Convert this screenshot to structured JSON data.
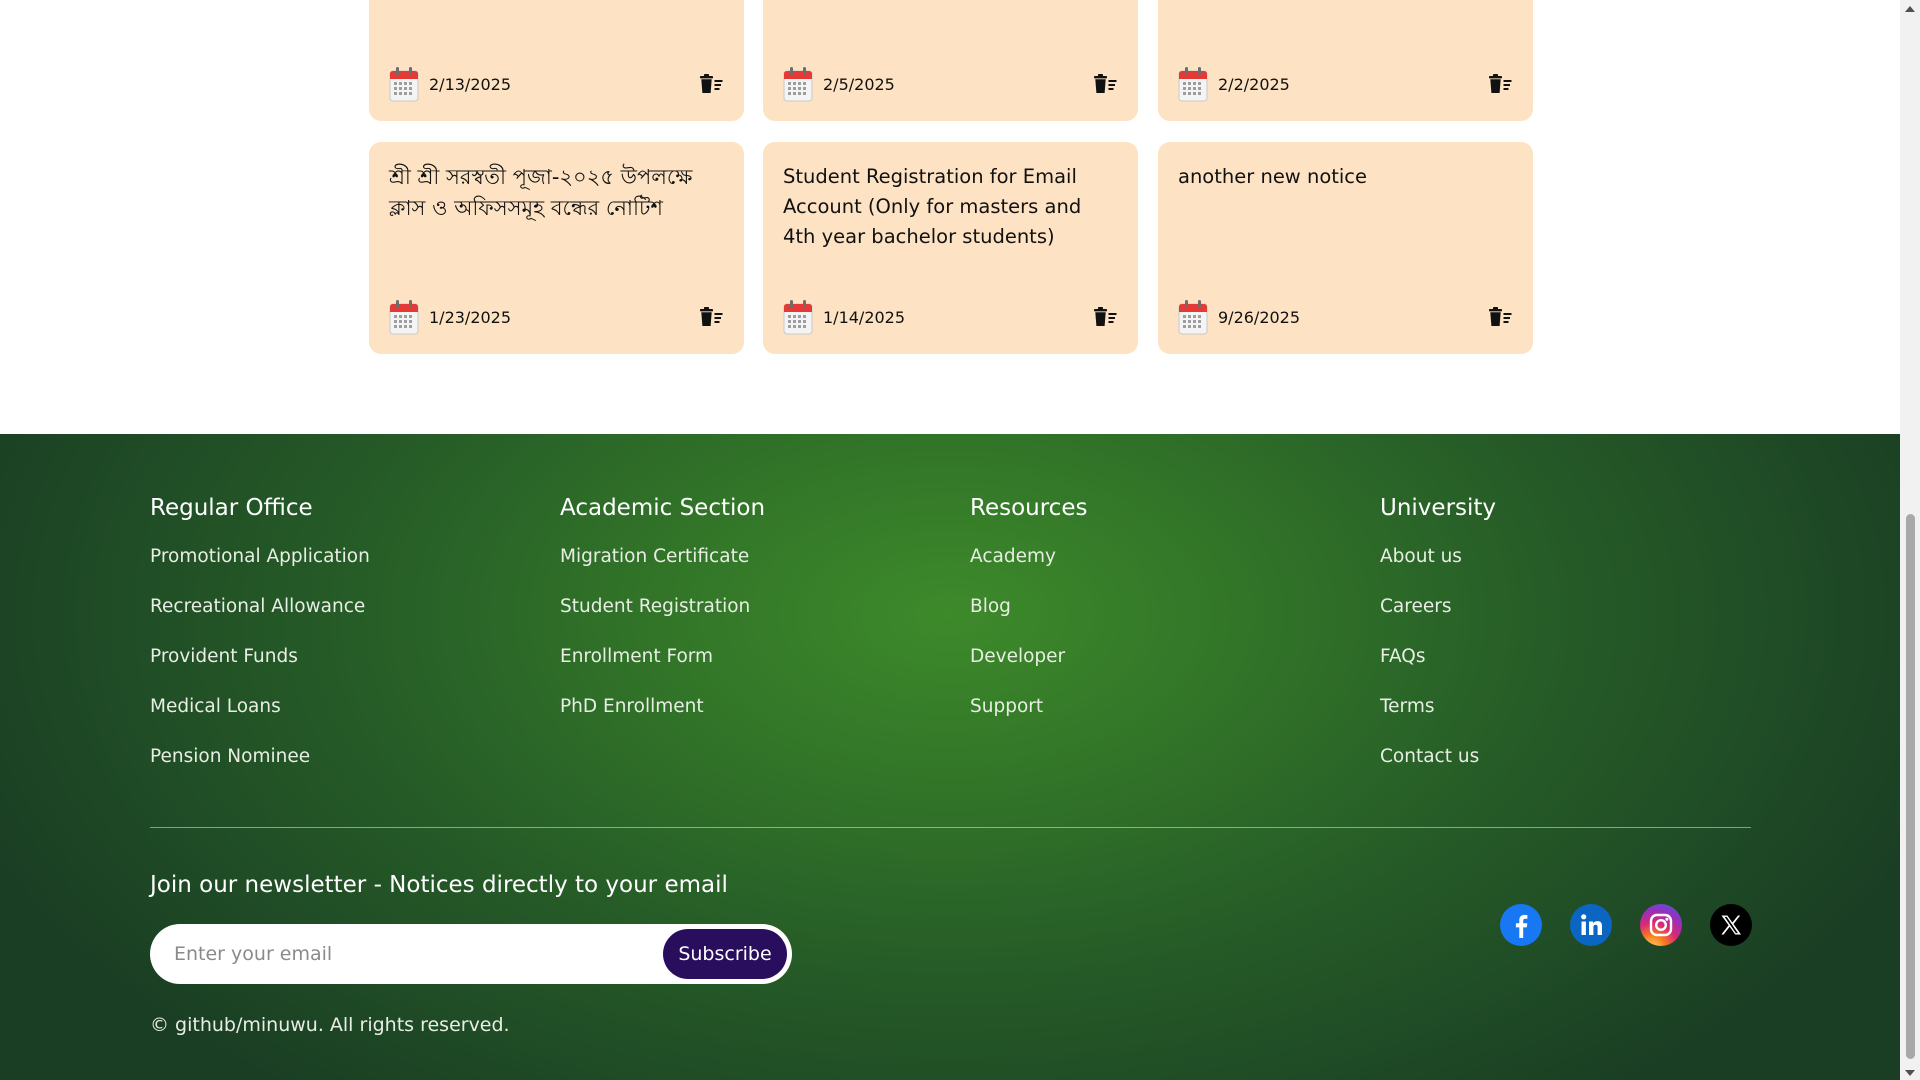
{
  "notices": {
    "row1": [
      {
        "title": "",
        "date": "2/13/2025",
        "icon": "calendar-icon",
        "action_icon": "delete-icon"
      },
      {
        "title": "",
        "date": "2/5/2025",
        "icon": "calendar-icon",
        "action_icon": "delete-icon"
      },
      {
        "title": "",
        "date": "2/2/2025",
        "icon": "calendar-icon",
        "action_icon": "delete-icon"
      }
    ],
    "row2": [
      {
        "title": "শ্রী শ্রী সরস্বতী পূজা-২০২৫ উপলক্ষে ক্লাস ও অফিসসমূহ বন্ধের নোটিশ",
        "date": "1/23/2025",
        "icon": "calendar-icon",
        "action_icon": "delete-icon"
      },
      {
        "title": "Student Registration for Email Account (Only for masters and 4th year bachelor students)",
        "date": "1/14/2025",
        "icon": "calendar-icon",
        "action_icon": "delete-icon"
      },
      {
        "title": "another new notice",
        "date": "9/26/2025",
        "icon": "calendar-icon",
        "action_icon": "delete-icon"
      }
    ]
  },
  "footer": {
    "columns": [
      {
        "title": "Regular Office",
        "links": [
          "Promotional Application",
          "Recreational Allowance",
          "Provident Funds",
          "Medical Loans",
          "Pension Nominee"
        ]
      },
      {
        "title": "Academic Section",
        "links": [
          "Migration Certificate",
          "Student Registration",
          "Enrollment Form",
          "PhD Enrollment"
        ]
      },
      {
        "title": "Resources",
        "links": [
          "Academy",
          "Blog",
          "Developer",
          "Support"
        ]
      },
      {
        "title": "University",
        "links": [
          "About us",
          "Careers",
          "FAQs",
          "Terms",
          "Contact us"
        ]
      }
    ],
    "newsletter": {
      "title": "Join our newsletter - Notices directly to your email",
      "placeholder": "Enter your email",
      "button_label": "Subscribe"
    },
    "copyright": "© github/minuwu. All rights reserved.",
    "social": [
      {
        "icon": "facebook-icon",
        "color": "#1877f2"
      },
      {
        "icon": "linkedin-icon",
        "color": "#0a66c2"
      },
      {
        "icon": "instagram-icon",
        "color": "#e1306c"
      },
      {
        "icon": "x-icon",
        "color": "#000000"
      }
    ]
  },
  "colors": {
    "card_background": "#fde3c3",
    "footer_green": "#2f6f28",
    "footer_dark": "#1a3e24",
    "subscribe_button": "#2a0e5e"
  }
}
